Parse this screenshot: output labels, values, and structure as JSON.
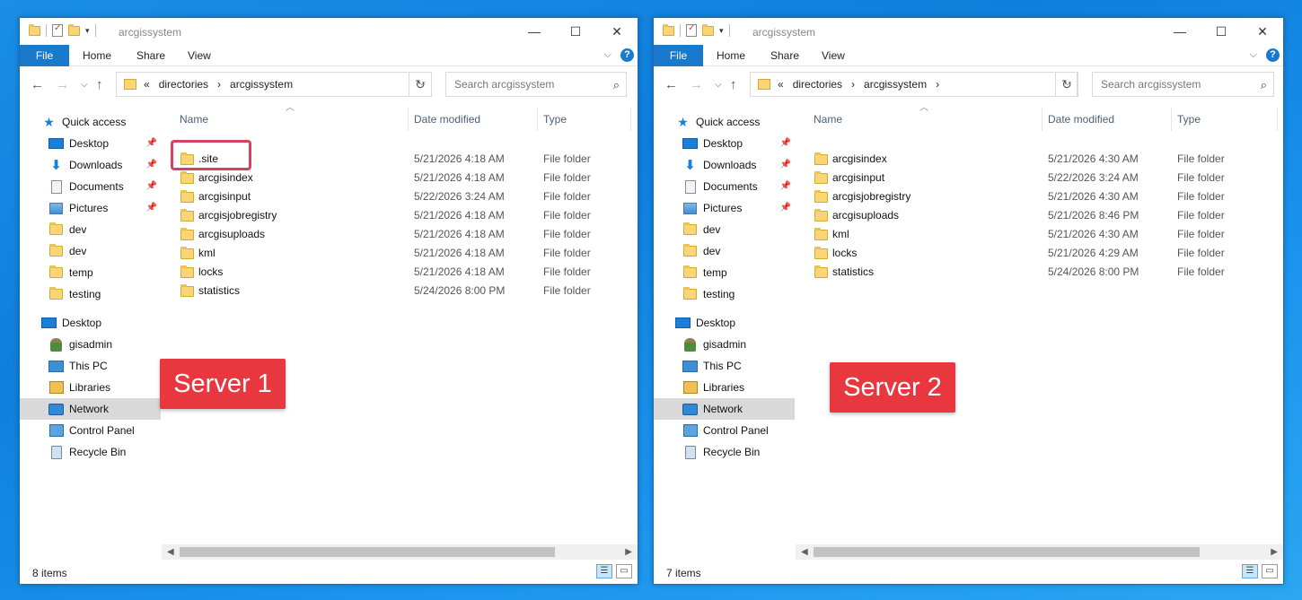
{
  "windows": [
    {
      "title": "arcgissystem",
      "ribbon_tabs": [
        "File",
        "Home",
        "Share",
        "View"
      ],
      "breadcrumb": {
        "prefix": "«",
        "parts": [
          "directories",
          "arcgissystem"
        ],
        "separator": "›"
      },
      "search_placeholder": "Search arcgissystem",
      "columns": {
        "name": "Name",
        "date": "Date modified",
        "type": "Type"
      },
      "sidebar": [
        {
          "label": "Quick access",
          "icon": "star-icon",
          "pinned": false
        },
        {
          "label": "Desktop",
          "icon": "desktop-icon",
          "pinned": true
        },
        {
          "label": "Downloads",
          "icon": "download-icon",
          "pinned": true
        },
        {
          "label": "Documents",
          "icon": "documents-icon",
          "pinned": true
        },
        {
          "label": "Pictures",
          "icon": "pictures-icon",
          "pinned": true
        },
        {
          "label": "dev",
          "icon": "folder-icon",
          "pinned": false
        },
        {
          "label": "dev",
          "icon": "folder-icon",
          "pinned": false
        },
        {
          "label": "temp",
          "icon": "folder-icon",
          "pinned": false
        },
        {
          "label": "testing",
          "icon": "folder-icon",
          "pinned": false
        },
        {
          "label": "Desktop",
          "icon": "desktop-icon",
          "pinned": false
        },
        {
          "label": "gisadmin",
          "icon": "user-icon",
          "pinned": false
        },
        {
          "label": "This PC",
          "icon": "computer-icon",
          "pinned": false
        },
        {
          "label": "Libraries",
          "icon": "libraries-icon",
          "pinned": false
        },
        {
          "label": "Network",
          "icon": "network-icon",
          "pinned": false,
          "selected": true
        },
        {
          "label": "Control Panel",
          "icon": "control-panel-icon",
          "pinned": false
        },
        {
          "label": "Recycle Bin",
          "icon": "recycle-bin-icon",
          "pinned": false
        }
      ],
      "files": [
        {
          "name": ".site",
          "date": "5/21/2026 4:18 AM",
          "type": "File folder",
          "highlighted": true
        },
        {
          "name": "arcgisindex",
          "date": "5/21/2026 4:18 AM",
          "type": "File folder"
        },
        {
          "name": "arcgisinput",
          "date": "5/22/2026 3:24 AM",
          "type": "File folder"
        },
        {
          "name": "arcgisjobregistry",
          "date": "5/21/2026 4:18 AM",
          "type": "File folder"
        },
        {
          "name": "arcgisuploads",
          "date": "5/21/2026 4:18 AM",
          "type": "File folder"
        },
        {
          "name": "kml",
          "date": "5/21/2026 4:18 AM",
          "type": "File folder"
        },
        {
          "name": "locks",
          "date": "5/21/2026 4:18 AM",
          "type": "File folder"
        },
        {
          "name": "statistics",
          "date": "5/24/2026 8:00 PM",
          "type": "File folder"
        }
      ],
      "status": "8 items",
      "label": "Server 1"
    },
    {
      "title": "arcgissystem",
      "ribbon_tabs": [
        "File",
        "Home",
        "Share",
        "View"
      ],
      "breadcrumb": {
        "prefix": "«",
        "parts": [
          "directories",
          "arcgissystem"
        ],
        "separator": "›"
      },
      "search_placeholder": "Search arcgissystem",
      "columns": {
        "name": "Name",
        "date": "Date modified",
        "type": "Type"
      },
      "sidebar": [
        {
          "label": "Quick access",
          "icon": "star-icon",
          "pinned": false
        },
        {
          "label": "Desktop",
          "icon": "desktop-icon",
          "pinned": true
        },
        {
          "label": "Downloads",
          "icon": "download-icon",
          "pinned": true
        },
        {
          "label": "Documents",
          "icon": "documents-icon",
          "pinned": true
        },
        {
          "label": "Pictures",
          "icon": "pictures-icon",
          "pinned": true
        },
        {
          "label": "dev",
          "icon": "folder-icon",
          "pinned": false
        },
        {
          "label": "dev",
          "icon": "folder-icon",
          "pinned": false
        },
        {
          "label": "temp",
          "icon": "folder-icon",
          "pinned": false
        },
        {
          "label": "testing",
          "icon": "folder-icon",
          "pinned": false
        },
        {
          "label": "Desktop",
          "icon": "desktop-icon",
          "pinned": false
        },
        {
          "label": "gisadmin",
          "icon": "user-icon",
          "pinned": false
        },
        {
          "label": "This PC",
          "icon": "computer-icon",
          "pinned": false
        },
        {
          "label": "Libraries",
          "icon": "libraries-icon",
          "pinned": false
        },
        {
          "label": "Network",
          "icon": "network-icon",
          "pinned": false,
          "selected": true
        },
        {
          "label": "Control Panel",
          "icon": "control-panel-icon",
          "pinned": false
        },
        {
          "label": "Recycle Bin",
          "icon": "recycle-bin-icon",
          "pinned": false
        }
      ],
      "files": [
        {
          "name": "arcgisindex",
          "date": "5/21/2026 4:30 AM",
          "type": "File folder"
        },
        {
          "name": "arcgisinput",
          "date": "5/22/2026 3:24 AM",
          "type": "File folder"
        },
        {
          "name": "arcgisjobregistry",
          "date": "5/21/2026 4:30 AM",
          "type": "File folder"
        },
        {
          "name": "arcgisuploads",
          "date": "5/21/2026 8:46 PM",
          "type": "File folder"
        },
        {
          "name": "kml",
          "date": "5/21/2026 4:30 AM",
          "type": "File folder"
        },
        {
          "name": "locks",
          "date": "5/21/2026 4:29 AM",
          "type": "File folder"
        },
        {
          "name": "statistics",
          "date": "5/24/2026 8:00 PM",
          "type": "File folder"
        }
      ],
      "status": "7 items",
      "label": "Server 2"
    }
  ],
  "colors": {
    "accent": "#1979ca",
    "label_bg": "#e8373e",
    "highlight_border": "#d9405c",
    "desktop_bg": "#1a8de6"
  }
}
